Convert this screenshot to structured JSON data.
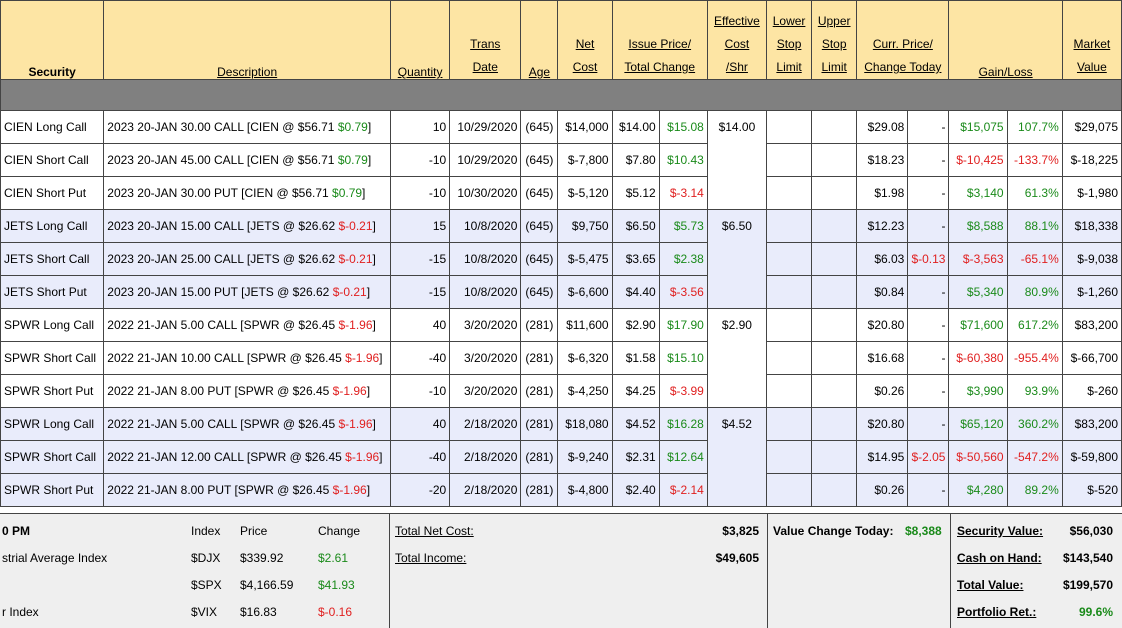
{
  "headers": {
    "security": "Security",
    "description": "Description",
    "quantity": "Quantity",
    "trans_date": [
      "Trans",
      "Date"
    ],
    "age": "Age",
    "net_cost": [
      "Net",
      "Cost"
    ],
    "issue_price": [
      "Issue Price/",
      "Total Change"
    ],
    "effective_cost": [
      "Effective",
      "Cost",
      "/Shr"
    ],
    "lower_stop": [
      "Lower",
      "Stop",
      "Limit"
    ],
    "upper_stop": [
      "Upper",
      "Stop",
      "Limit"
    ],
    "curr_price": [
      "Curr. Price/",
      "Change Today"
    ],
    "gain_loss": "Gain/Loss",
    "market_value": [
      "Market",
      "Value"
    ]
  },
  "rows": [
    {
      "security": "CIEN Long Call",
      "desc": "2023 20-JAN 30.00 CALL [CIEN @ $56.71 ",
      "desc_chg": "$0.79",
      "desc_sign": "pos",
      "qty": "10",
      "date": "10/29/2020",
      "age": "(645)",
      "net_cost": "$14,000",
      "issue": "$14.00",
      "total_chg": "$15.08",
      "tc_sign": "pos",
      "eff": "$14.00",
      "curr": "$29.08",
      "today": "-",
      "today_sign": "",
      "gain": "$15,075",
      "pct": "107.7%",
      "gain_sign": "pos",
      "mv": "$29,075",
      "shade": "w"
    },
    {
      "security": "CIEN Short Call",
      "desc": "2023 20-JAN 45.00 CALL [CIEN @ $56.71 ",
      "desc_chg": "$0.79",
      "desc_sign": "pos",
      "qty": "-10",
      "date": "10/29/2020",
      "age": "(645)",
      "net_cost": "$-7,800",
      "issue": "$7.80",
      "total_chg": "$10.43",
      "tc_sign": "pos",
      "eff": "",
      "curr": "$18.23",
      "today": "-",
      "today_sign": "",
      "gain": "$-10,425",
      "pct": "-133.7%",
      "gain_sign": "neg",
      "mv": "$-18,225",
      "shade": "w"
    },
    {
      "security": "CIEN Short Put",
      "desc": "2023 20-JAN 30.00 PUT [CIEN @ $56.71 ",
      "desc_chg": "$0.79",
      "desc_sign": "pos",
      "qty": "-10",
      "date": "10/30/2020",
      "age": "(645)",
      "net_cost": "$-5,120",
      "issue": "$5.12",
      "total_chg": "$-3.14",
      "tc_sign": "neg",
      "eff": "",
      "curr": "$1.98",
      "today": "-",
      "today_sign": "",
      "gain": "$3,140",
      "pct": "61.3%",
      "gain_sign": "pos",
      "mv": "$-1,980",
      "shade": "w"
    },
    {
      "security": "JETS Long Call",
      "desc": "2023 20-JAN 15.00 CALL [JETS @ $26.62 ",
      "desc_chg": "$-0.21",
      "desc_sign": "neg",
      "qty": "15",
      "date": "10/8/2020",
      "age": "(645)",
      "net_cost": "$9,750",
      "issue": "$6.50",
      "total_chg": "$5.73",
      "tc_sign": "pos",
      "eff": "$6.50",
      "curr": "$12.23",
      "today": "-",
      "today_sign": "",
      "gain": "$8,588",
      "pct": "88.1%",
      "gain_sign": "pos",
      "mv": "$18,338",
      "shade": "b"
    },
    {
      "security": "JETS Short Call",
      "desc": "2023 20-JAN 25.00 CALL [JETS @ $26.62 ",
      "desc_chg": "$-0.21",
      "desc_sign": "neg",
      "qty": "-15",
      "date": "10/8/2020",
      "age": "(645)",
      "net_cost": "$-5,475",
      "issue": "$3.65",
      "total_chg": "$2.38",
      "tc_sign": "pos",
      "eff": "",
      "curr": "$6.03",
      "today": "$-0.13",
      "today_sign": "neg",
      "gain": "$-3,563",
      "pct": "-65.1%",
      "gain_sign": "neg",
      "mv": "$-9,038",
      "shade": "b"
    },
    {
      "security": "JETS Short Put",
      "desc": "2023 20-JAN 15.00 PUT [JETS @ $26.62 ",
      "desc_chg": "$-0.21",
      "desc_sign": "neg",
      "qty": "-15",
      "date": "10/8/2020",
      "age": "(645)",
      "net_cost": "$-6,600",
      "issue": "$4.40",
      "total_chg": "$-3.56",
      "tc_sign": "neg",
      "eff": "",
      "curr": "$0.84",
      "today": "-",
      "today_sign": "",
      "gain": "$5,340",
      "pct": "80.9%",
      "gain_sign": "pos",
      "mv": "$-1,260",
      "shade": "b"
    },
    {
      "security": "SPWR Long Call",
      "desc": "2022 21-JAN 5.00 CALL [SPWR @ $26.45 ",
      "desc_chg": "$-1.96",
      "desc_sign": "neg",
      "qty": "40",
      "date": "3/20/2020",
      "age": "(281)",
      "net_cost": "$11,600",
      "issue": "$2.90",
      "total_chg": "$17.90",
      "tc_sign": "pos",
      "eff": "$2.90",
      "curr": "$20.80",
      "today": "-",
      "today_sign": "",
      "gain": "$71,600",
      "pct": "617.2%",
      "gain_sign": "pos",
      "mv": "$83,200",
      "shade": "w"
    },
    {
      "security": "SPWR Short Call",
      "desc": "2022 21-JAN 10.00 CALL [SPWR @ $26.45 ",
      "desc_chg": "$-1.96",
      "desc_sign": "neg",
      "qty": "-40",
      "date": "3/20/2020",
      "age": "(281)",
      "net_cost": "$-6,320",
      "issue": "$1.58",
      "total_chg": "$15.10",
      "tc_sign": "pos",
      "eff": "",
      "curr": "$16.68",
      "today": "-",
      "today_sign": "",
      "gain": "$-60,380",
      "pct": "-955.4%",
      "gain_sign": "neg",
      "mv": "$-66,700",
      "shade": "w"
    },
    {
      "security": "SPWR Short Put",
      "desc": "2022 21-JAN 8.00 PUT [SPWR @ $26.45 ",
      "desc_chg": "$-1.96",
      "desc_sign": "neg",
      "qty": "-10",
      "date": "3/20/2020",
      "age": "(281)",
      "net_cost": "$-4,250",
      "issue": "$4.25",
      "total_chg": "$-3.99",
      "tc_sign": "neg",
      "eff": "",
      "curr": "$0.26",
      "today": "-",
      "today_sign": "",
      "gain": "$3,990",
      "pct": "93.9%",
      "gain_sign": "pos",
      "mv": "$-260",
      "shade": "w"
    },
    {
      "security": "SPWR Long Call",
      "desc": "2022 21-JAN 5.00 CALL [SPWR @ $26.45 ",
      "desc_chg": "$-1.96",
      "desc_sign": "neg",
      "qty": "40",
      "date": "2/18/2020",
      "age": "(281)",
      "net_cost": "$18,080",
      "issue": "$4.52",
      "total_chg": "$16.28",
      "tc_sign": "pos",
      "eff": "$4.52",
      "curr": "$20.80",
      "today": "-",
      "today_sign": "",
      "gain": "$65,120",
      "pct": "360.2%",
      "gain_sign": "pos",
      "mv": "$83,200",
      "shade": "b"
    },
    {
      "security": "SPWR Short Call",
      "desc": "2022 21-JAN 12.00 CALL [SPWR @ $26.45 ",
      "desc_chg": "$-1.96",
      "desc_sign": "neg",
      "qty": "-40",
      "date": "2/18/2020",
      "age": "(281)",
      "net_cost": "$-9,240",
      "issue": "$2.31",
      "total_chg": "$12.64",
      "tc_sign": "pos",
      "eff": "",
      "curr": "$14.95",
      "today": "$-2.05",
      "today_sign": "neg",
      "gain": "$-50,560",
      "pct": "-547.2%",
      "gain_sign": "neg",
      "mv": "$-59,800",
      "shade": "b"
    },
    {
      "security": "SPWR Short Put",
      "desc": "2022 21-JAN 8.00 PUT [SPWR @ $26.45 ",
      "desc_chg": "$-1.96",
      "desc_sign": "neg",
      "qty": "-20",
      "date": "2/18/2020",
      "age": "(281)",
      "net_cost": "$-4,800",
      "issue": "$2.40",
      "total_chg": "$-2.14",
      "tc_sign": "neg",
      "eff": "",
      "curr": "$0.26",
      "today": "-",
      "today_sign": "",
      "gain": "$4,280",
      "pct": "89.2%",
      "gain_sign": "pos",
      "mv": "$-520",
      "shade": "b"
    }
  ],
  "footer": {
    "time_label": "0 PM",
    "index_headers": {
      "index": "Index",
      "price": "Price",
      "change": "Change"
    },
    "indices": [
      {
        "name": "strial Average Index",
        "symbol": "$DJX",
        "price": "$339.92",
        "change": "$2.61",
        "sign": "pos"
      },
      {
        "name": "",
        "symbol": "$SPX",
        "price": "$4,166.59",
        "change": "$41.93",
        "sign": "pos"
      },
      {
        "name": "r Index",
        "symbol": "$VIX",
        "price": "$16.83",
        "change": "$-0.16",
        "sign": "neg"
      }
    ],
    "total_net_cost_label": "Total Net Cost:",
    "total_net_cost": "$3,825",
    "total_income_label": "Total Income:",
    "total_income": "$49,605",
    "value_change_label": "Value Change Today:",
    "value_change": "$8,388",
    "security_value_label": "Security Value:",
    "security_value": "$56,030",
    "cash_label": "Cash on Hand:",
    "cash": "$143,540",
    "total_value_label": "Total Value:",
    "total_value": "$199,570",
    "portfolio_ret_label": "Portfolio Ret.:",
    "portfolio_ret": "99.6%"
  },
  "colors": {
    "header_bg": "#fde5a4",
    "separator": "#808080",
    "alt_row": "#e9ecfb",
    "positive": "#1a8a1a",
    "negative": "#e02020",
    "footer_bg": "#efefef"
  }
}
